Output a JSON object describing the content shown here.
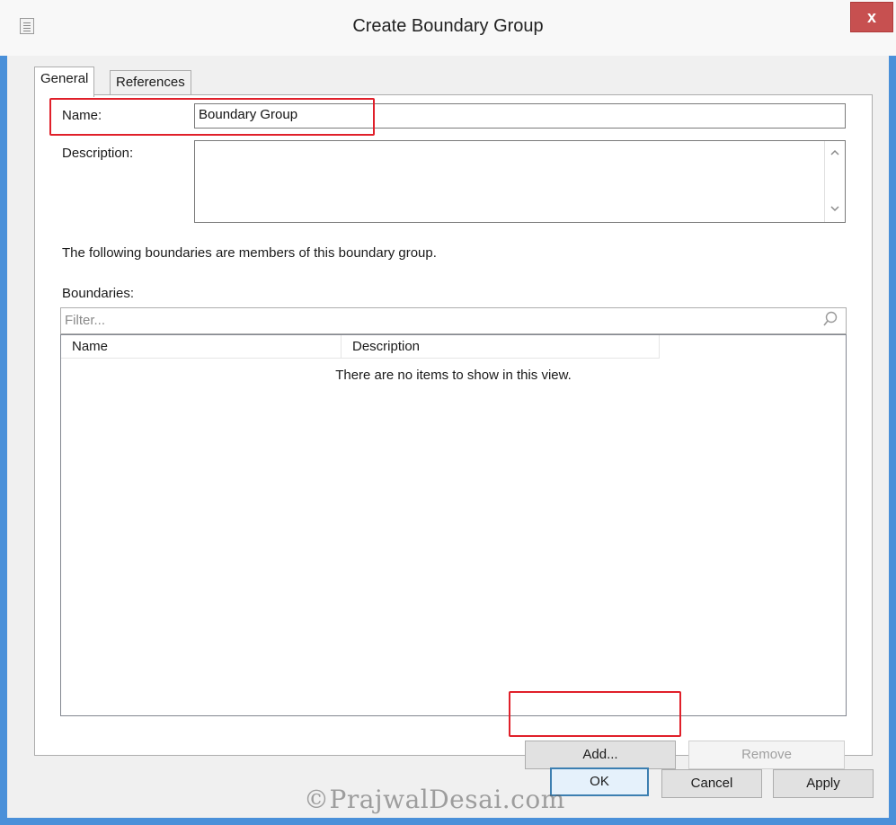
{
  "window": {
    "title": "Create Boundary Group",
    "close_label": "x"
  },
  "tabs": [
    {
      "label": "General",
      "active": true
    },
    {
      "label": "References",
      "active": false
    }
  ],
  "form": {
    "name_label": "Name:",
    "name_value": "Boundary Group",
    "description_label": "Description:",
    "description_value": "",
    "info_text": "The following boundaries are members of this boundary group.",
    "boundaries_label": "Boundaries:",
    "filter_placeholder": "Filter..."
  },
  "list": {
    "columns": [
      "Name",
      "Description"
    ],
    "empty_message": "There are no items to show in this view.",
    "rows": []
  },
  "buttons": {
    "add": "Add...",
    "remove": "Remove",
    "ok": "OK",
    "cancel": "Cancel",
    "apply": "Apply"
  },
  "watermark": "©PrajwalDesai.com",
  "colors": {
    "highlight": "#e0202a",
    "close_button": "#c75050",
    "window_border": "#4a90d9"
  },
  "icons": {
    "title": "dialog-icon",
    "close": "close-icon",
    "search": "search-icon",
    "scroll_up": "chevron-up-icon",
    "scroll_down": "chevron-down-icon"
  }
}
